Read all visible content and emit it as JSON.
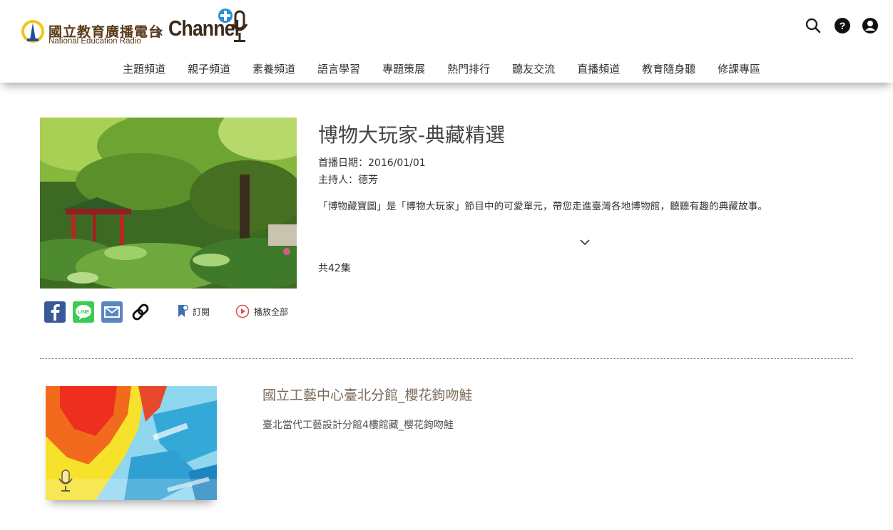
{
  "header": {
    "logo": {
      "cn_text": "國立教育廣播電台",
      "en_text": "National Education Radio",
      "x_mark": "×",
      "channel_text": "Channel"
    },
    "icons": [
      "search-icon",
      "help-icon",
      "user-icon"
    ],
    "nav": [
      {
        "label": "主題頻道"
      },
      {
        "label": "親子頻道"
      },
      {
        "label": "素養頻道"
      },
      {
        "label": "語言學習"
      },
      {
        "label": "專題策展"
      },
      {
        "label": "熱門排行"
      },
      {
        "label": "聽友交流"
      },
      {
        "label": "直播頻道"
      },
      {
        "label": "教育隨身聽"
      },
      {
        "label": "修課專區"
      }
    ]
  },
  "program": {
    "title": "博物大玩家-典藏精選",
    "premiere_label": "首播日期：",
    "premiere_value": "2016/01/01",
    "host_label": "主持人：",
    "host_value": "德芳",
    "description": "「博物藏寶圖」是「博物大玩家」節目中的可愛單元，帶您走進臺灣各地博物館，聽聽有趣的典藏故事。",
    "episode_count": "共42集",
    "share": {
      "facebook_icon": "facebook-icon",
      "line_label": "LINE",
      "mail_icon": "mail-icon",
      "link_icon": "link-icon"
    },
    "subscribe_label": "訂閱",
    "play_all_label": "播放全部"
  },
  "episode": {
    "title": "國立工藝中心臺北分館_櫻花鉤吻鮭",
    "description": "臺北當代工藝設計分館4樓館藏_櫻花鉤吻鮭"
  },
  "colors": {
    "facebook": "#3b5998",
    "line": "#3acc52",
    "mail": "#5a86c3",
    "bookmark": "#3d6fb0",
    "play": "#d9534f",
    "logo_brown": "#5a3a18",
    "channel_blue": "#2a8fd0"
  }
}
